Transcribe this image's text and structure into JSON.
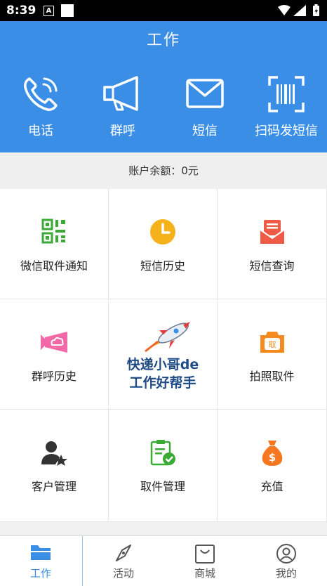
{
  "status_bar": {
    "time": "8:39",
    "notification_badge": "A",
    "icons": [
      "wifi-icon",
      "signal-icon",
      "battery-icon"
    ]
  },
  "header": {
    "title": "工作"
  },
  "quick_actions": [
    {
      "label": "电话",
      "icon": "phone-icon"
    },
    {
      "label": "群呼",
      "icon": "megaphone-icon"
    },
    {
      "label": "短信",
      "icon": "envelope-icon"
    },
    {
      "label": "扫码发短信",
      "icon": "barcode-scan-icon"
    }
  ],
  "balance": {
    "text": "账户余额：0元"
  },
  "grid": {
    "items": [
      {
        "label": "微信取件通知",
        "icon": "qrcode-icon",
        "color": "#3aa935"
      },
      {
        "label": "短信历史",
        "icon": "clock-icon",
        "color": "#f5b21b"
      },
      {
        "label": "短信查询",
        "icon": "mail-open-icon",
        "color": "#ef5a46"
      },
      {
        "label": "群呼历史",
        "icon": "megaphone-cloud-icon",
        "color": "#f269a8"
      },
      {
        "label": "拍照取件",
        "icon": "camera-icon",
        "color": "#f58a1f"
      },
      {
        "label": "客户管理",
        "icon": "user-star-icon",
        "color": "#333333"
      },
      {
        "label": "取件管理",
        "icon": "clipboard-check-icon",
        "color": "#3aa935"
      },
      {
        "label": "充值",
        "icon": "money-bag-icon",
        "color": "#f5771f"
      }
    ],
    "promo": {
      "line1": "快递小哥de",
      "line2": "工作好帮手",
      "icon": "rocket-icon"
    }
  },
  "tabs": [
    {
      "label": "工作",
      "icon": "folder-icon",
      "active": true
    },
    {
      "label": "活动",
      "icon": "compass-icon",
      "active": false
    },
    {
      "label": "商城",
      "icon": "shopping-bag-icon",
      "active": false
    },
    {
      "label": "我的",
      "icon": "profile-icon",
      "active": false
    }
  ],
  "colors": {
    "primary": "#3a8ee6",
    "background": "#f2f2f2"
  }
}
